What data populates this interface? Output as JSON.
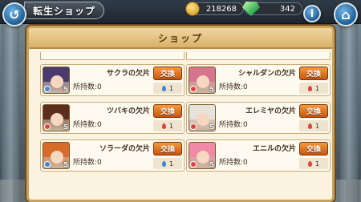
{
  "header": {
    "title": "転生ショップ"
  },
  "currency": {
    "gold": "218268",
    "gems": "342"
  },
  "panel": {
    "title": "ショップ"
  },
  "labels": {
    "owned": "所持数:0",
    "exchange": "交換"
  },
  "items": [
    {
      "name": "サクラの欠片",
      "count": "5",
      "cost": "1",
      "hair": "#4b3a6e",
      "element": "#3b86d6",
      "cost_color": "blue"
    },
    {
      "name": "シャルダンの欠片",
      "count": "5",
      "cost": "1",
      "hair": "#d9748f",
      "element": "#e0413c",
      "cost_color": "red"
    },
    {
      "name": "ツバキの欠片",
      "count": "5",
      "cost": "1",
      "hair": "#5a2f1e",
      "element": "#e0413c",
      "cost_color": "red"
    },
    {
      "name": "エレミヤの欠片",
      "count": "5",
      "cost": "1",
      "hair": "#e8e2dc",
      "element": "#e0413c",
      "cost_color": "red"
    },
    {
      "name": "ソラーダの欠片",
      "count": "5",
      "cost": "1",
      "hair": "#d86a2a",
      "element": "#3b86d6",
      "cost_color": "blue"
    },
    {
      "name": "エニルの欠片",
      "count": "5",
      "cost": "1",
      "hair": "#f08aa6",
      "element": "#e0413c",
      "cost_color": "red"
    }
  ]
}
